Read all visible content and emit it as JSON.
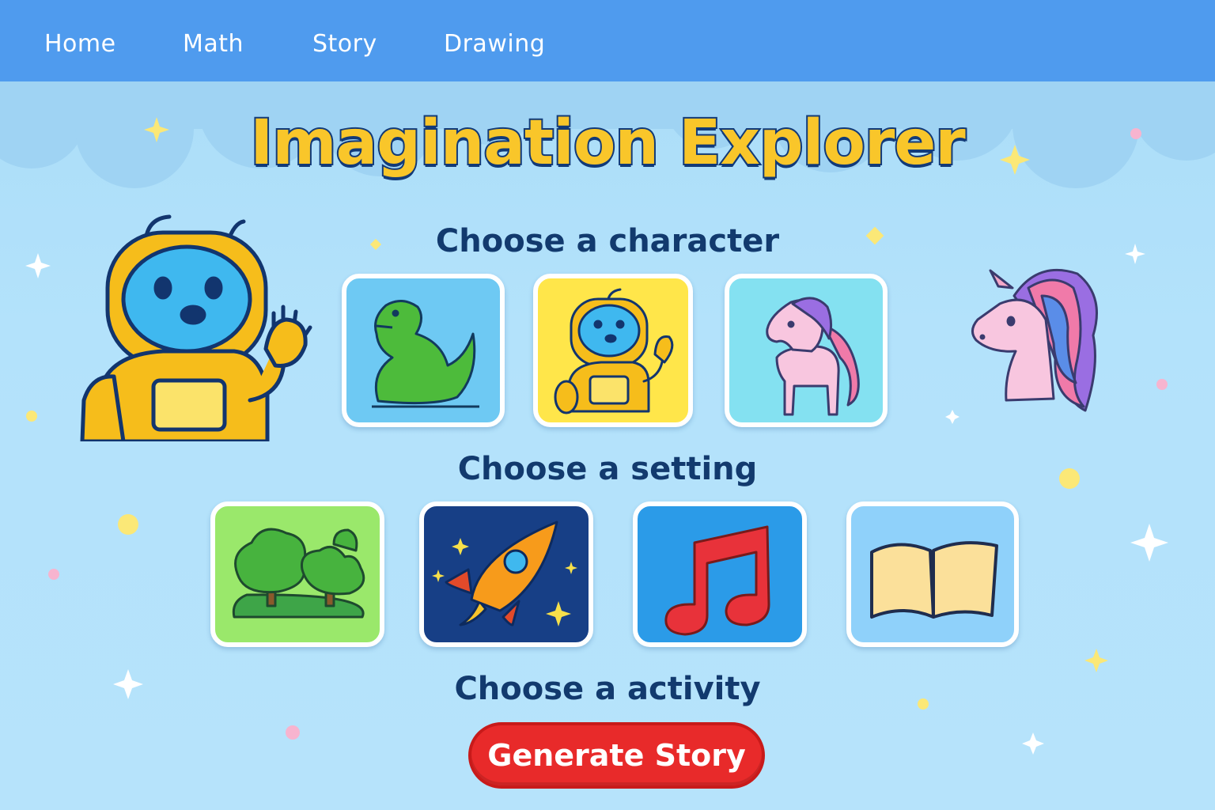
{
  "nav": {
    "items": [
      {
        "label": "Home"
      },
      {
        "label": "Math"
      },
      {
        "label": "Story"
      },
      {
        "label": "Drawing"
      }
    ]
  },
  "title": "Imagination Explorer",
  "character_section": {
    "heading": "Choose a character",
    "options": [
      {
        "icon": "dinosaur-icon",
        "bg": "#6ec9f3"
      },
      {
        "icon": "robot-icon",
        "bg": "#ffe64a",
        "selected": true
      },
      {
        "icon": "pony-icon",
        "bg": "#84e1f1"
      }
    ]
  },
  "setting_section": {
    "heading": "Choose a setting",
    "options": [
      {
        "icon": "forest-icon",
        "bg": "#9ae86b"
      },
      {
        "icon": "rocket-icon",
        "bg": "#173f86"
      },
      {
        "icon": "music-note-icon",
        "bg": "#2b9be8"
      },
      {
        "icon": "open-book-icon",
        "bg": "#8fd1fa"
      }
    ]
  },
  "activity_section": {
    "heading": "Choose a activity",
    "button_label": "Generate Story"
  },
  "decorations": [
    "robot-mascot",
    "unicorn-mascot",
    "sparkle-icon"
  ],
  "colors": {
    "nav_bg": "#4f9bee",
    "title_fill": "#f9c62a",
    "title_outline": "#123a78",
    "heading": "#123a6e",
    "button": "#e82a2a"
  }
}
